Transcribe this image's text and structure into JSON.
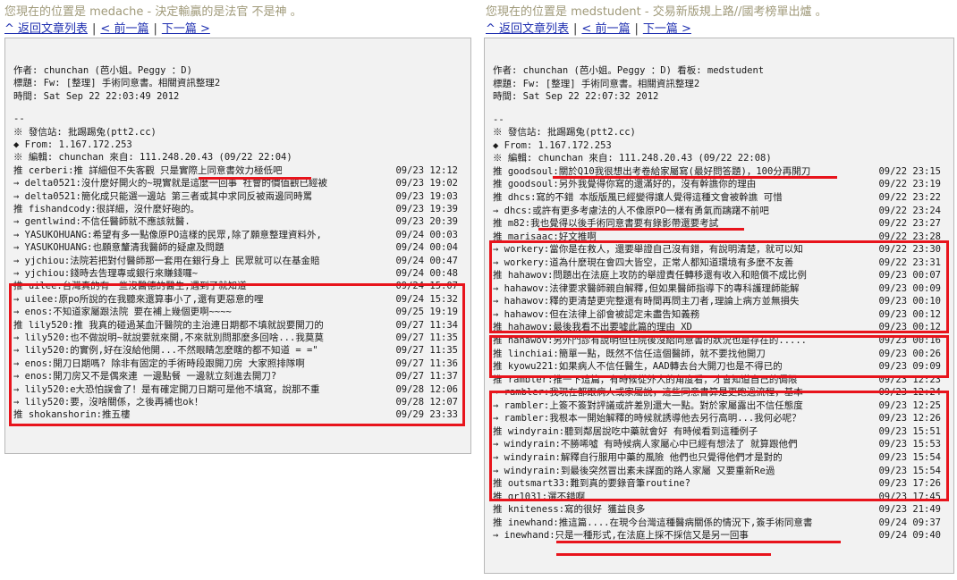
{
  "left": {
    "breadcrumb": "您現在的位置是 medache - 決定輸贏的是法官 不是神 。",
    "nav": {
      "back": "^ 返回文章列表",
      "prev": "< 前一篇",
      "next": "下一篇 >"
    },
    "header": [
      "作者: chunchan (芭小姐。Peggy ：D)",
      "標題: Fw: [整理] 手術同意書。相關資訊整理2",
      "時間: Sat Sep 22 22:03:49 2012"
    ],
    "sep": "--",
    "meta": [
      "※ 發信站: 批踢踢兔(ptt2.cc)",
      "◆ From: 1.167.172.253",
      "※ 編輯: chunchan          來自: 111.248.20.43          (09/22 22:04)"
    ],
    "pushes": [
      {
        "text": "推 cerberi:推 詳細但不失客觀 只是實際上同意書效力極低吧",
        "time": "09/23 12:12"
      },
      {
        "text": "→ delta0521:沒什麼好開火的~現實就是這麼一回事 社會的價值觀已經被",
        "time": "09/23 19:02"
      },
      {
        "text": "→ delta0521:簡化成只能選一邊站 第三者或其中求同反被兩邊同時罵",
        "time": "09/23 19:03"
      },
      {
        "text": "推 fishandcody:很詳細，沒什麼好砲的。",
        "time": "09/23 19:39"
      },
      {
        "text": "→ gentlwind:不信任醫師就不應該就醫.",
        "time": "09/23 20:39"
      },
      {
        "text": "→ YASUKOHUANG:希望有多一點像原PO這樣的民眾,除了願意整理資料外,",
        "time": "09/24 00:03"
      },
      {
        "text": "→ YASUKOHUANG:也願意釐清我醫師的疑慮及問題",
        "time": "09/24 00:04"
      },
      {
        "text": "→ yjchiou:法院若把對付醫師那一套用在銀行身上 民眾就可以在基金賠",
        "time": "09/24 00:47"
      },
      {
        "text": "→ yjchiou:錢時去告理專或銀行來賺錢囉~",
        "time": "09/24 00:48"
      },
      {
        "text": "推 uilee:台灣真的有一些沒醫德的醫生,遇到了就知道",
        "time": "09/24 15:07"
      },
      {
        "text": "→ uilee:原po所說的在我聽來還算事小了,還有更惡意的哩",
        "time": "09/24 15:32"
      },
      {
        "text": "→ enos:不知道家屬跟法院 要在補上幾個更啊~~~~",
        "time": "09/25 19:19"
      },
      {
        "text": "推 lily520:推 我真的碰過某血汗醫院的主治連日期都不填就說要開刀的",
        "time": "09/27 11:34"
      },
      {
        "text": "→ lily520:也不做說明~就說要就來開,不來就別問那麼多回啥...我莫莫",
        "time": "09/27 11:35"
      },
      {
        "text": "→ lily520:的實例,好在沒給他開...不然眼睛怎麼瞎的都不知道 = =\"",
        "time": "09/27 11:35"
      },
      {
        "text": "→ enos:開刀日期嗎? 除非有固定的手術時段跟開刀房 大家照排隊啊",
        "time": "09/27 11:36"
      },
      {
        "text": "→ enos:開刀房又不是偶來連 一邊點餐 一邊就立刻進去開刀?",
        "time": "09/27 11:37"
      },
      {
        "text": "→ lily520:e大恐怕誤會了！是有確定開刀日期可是他不填寫，說那不重",
        "time": "09/28 12:06"
      },
      {
        "text": "→ lily520:要，沒啥關係，之後再補也ok！",
        "time": "09/28 12:07"
      },
      {
        "text": "推 shokanshorin:推五樓",
        "time": "09/29 23:33"
      }
    ]
  },
  "right": {
    "breadcrumb": "您現在的位置是 medstudent - 交易新版規上路//國考榜單出爐 。",
    "nav": {
      "back": "^ 返回文章列表",
      "prev": "< 前一篇",
      "next": "下一篇 >"
    },
    "header": [
      "作者: chunchan (芭小姐。Peggy ：D) 看板: medstudent",
      "標題: Fw: [整理] 手術同意書。相關資訊整理2",
      "時間: Sat Sep 22 22:07:32 2012"
    ],
    "sep": "--",
    "meta": [
      "※ 發信站: 批踢踢兔(ptt2.cc)",
      "◆ From: 1.167.172.253",
      "※ 編輯: chunchan          來自: 111.248.20.43          (09/22 22:08)"
    ],
    "pushes": [
      {
        "text": "推 goodsoul:關於Q10我很想出考卷給家屬寫(最好問答題)，100分再開刀",
        "time": "09/22 23:15"
      },
      {
        "text": "推 goodsoul:另外我覺得你寫的還滿好的，沒有幹譙你的理由",
        "time": "09/22 23:19"
      },
      {
        "text": "推 dhcs:寫的不錯 本版版風已經變得讓人覺得這種文會被幹譙 可惜",
        "time": "09/22 23:22"
      },
      {
        "text": "→ dhcs:或許有更多考慮法的人不像原PO一樣有勇氣而躊躇不前吧",
        "time": "09/22 23:24"
      },
      {
        "text": "推 m82:我也覺得以後手術同意書要有錄影帶還要考試",
        "time": "09/22 23:27"
      },
      {
        "text": "推 marisaac:好文推啊",
        "time": "09/22 23:28"
      },
      {
        "text": "→ workery:當你是在救人，還要舉證自己沒有錯，有說明清楚，就可以知",
        "time": "09/22 23:30"
      },
      {
        "text": "→ workery:道為什麼現在會四大皆空，正常人都知道環境有多麼不友善",
        "time": "09/22 23:31"
      },
      {
        "text": "推 hahawov:問題出在法庭上攻防的舉證責任轉移還有收入和賠償不成比例",
        "time": "09/23 00:07"
      },
      {
        "text": "→ hahawov:法律要求醫師親自解釋,但如果醫師指導下的專科護理師能解",
        "time": "09/23 00:09"
      },
      {
        "text": "→ hahawov:釋的更清楚更完整還有時間再問主刀者,理論上病方並無損失",
        "time": "09/23 00:10"
      },
      {
        "text": "→ hahawov:但在法律上卻會被認定未盡告知義務",
        "time": "09/23 00:12"
      },
      {
        "text": "推 hahawov:最後我看不出要嘘此篇的理由 XD",
        "time": "09/23 00:12"
      },
      {
        "text": "推 hahawov:另外門診有說明但住院後沒給同意書的狀況也是存在的.....",
        "time": "09/23 00:16"
      },
      {
        "text": "推 linchiai:簡單一點，既然不信任這個醫師，就不要找他開刀",
        "time": "09/23 00:26"
      },
      {
        "text": "推 kyowu221:如果病人不信任醫生，AAD轉去台大開刀也是不得已的",
        "time": "09/23 09:09"
      },
      {
        "text": "推 rambler:推一下這篇，有時候從外人的角度看，才會知道自己的侷限",
        "time": "09/23 12:23"
      },
      {
        "text": "→ rambler:我現在都跟病人或家屬說，這些同意書算是更跑過流程，基本",
        "time": "09/23 12:24"
      },
      {
        "text": "→ rambler:上簽不簽對評議或許差別還大一點。對於家屬露出不信任態度",
        "time": "09/23 12:25"
      },
      {
        "text": "→ rambler:我根本一開始解釋的時候就誘導他去另行高明...我何必呢？",
        "time": "09/23 12:26"
      },
      {
        "text": "推 windyrain:聽到鄰居說吃中藥就會好   有時候看到這種例子",
        "time": "09/23 15:51"
      },
      {
        "text": "→ windyrain:不勝唏噓   有時候病人家屬心中已經有想法了   就算跟他們",
        "time": "09/23 15:53"
      },
      {
        "text": "→ windyrain:解釋自行服用中藥的風險   他們也只覺得他們才是對的",
        "time": "09/23 15:54"
      },
      {
        "text": "→ windyrain:到最後突然冒出素未謀面的路人家屬   又要重新Re過",
        "time": "09/23 15:54"
      },
      {
        "text": "推 outsmart33:難到真的要錄音筆routine?",
        "time": "09/23 17:26"
      },
      {
        "text": "推 gr1031:選不錯啊",
        "time": "09/23 17:45"
      },
      {
        "text": "推 kniteness:寫的很好 獲益良多",
        "time": "09/23 21:49"
      },
      {
        "text": "推 inewhand:推這篇....在現今台灣這種醫病關係的情況下,簽手術同意書",
        "time": "09/24 09:37"
      },
      {
        "text": "→ inewhand:只是一種形式,在法庭上採不採信又是另一回事",
        "time": "09/24 09:40"
      }
    ]
  }
}
